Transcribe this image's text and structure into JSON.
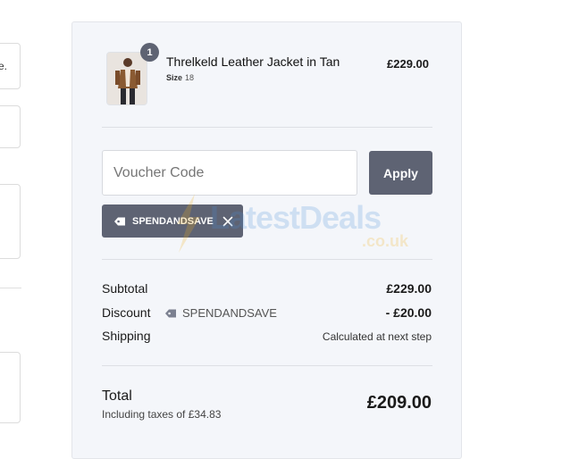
{
  "left_form": {
    "clipped_text": "e."
  },
  "cart": {
    "item": {
      "name": "Threlkeld Leather Jacket in Tan",
      "size_label": "Size",
      "size_value": "18",
      "price": "£229.00",
      "quantity": "1"
    }
  },
  "voucher": {
    "placeholder": "Voucher Code",
    "apply_label": "Apply",
    "applied_code": "SPENDANDSAVE"
  },
  "totals": {
    "subtotal_label": "Subtotal",
    "subtotal_value": "£229.00",
    "discount_label": "Discount",
    "discount_code": "SPENDANDSAVE",
    "discount_value": "- £20.00",
    "shipping_label": "Shipping",
    "shipping_value": "Calculated at next step",
    "total_label": "Total",
    "tax_note": "Including taxes of £34.83",
    "total_value": "£209.00"
  },
  "watermark": {
    "main": "LatestDeals",
    "sub": ".co.uk"
  },
  "colors": {
    "panel_bg": "#f4f6fa",
    "button": "#5e6373"
  }
}
